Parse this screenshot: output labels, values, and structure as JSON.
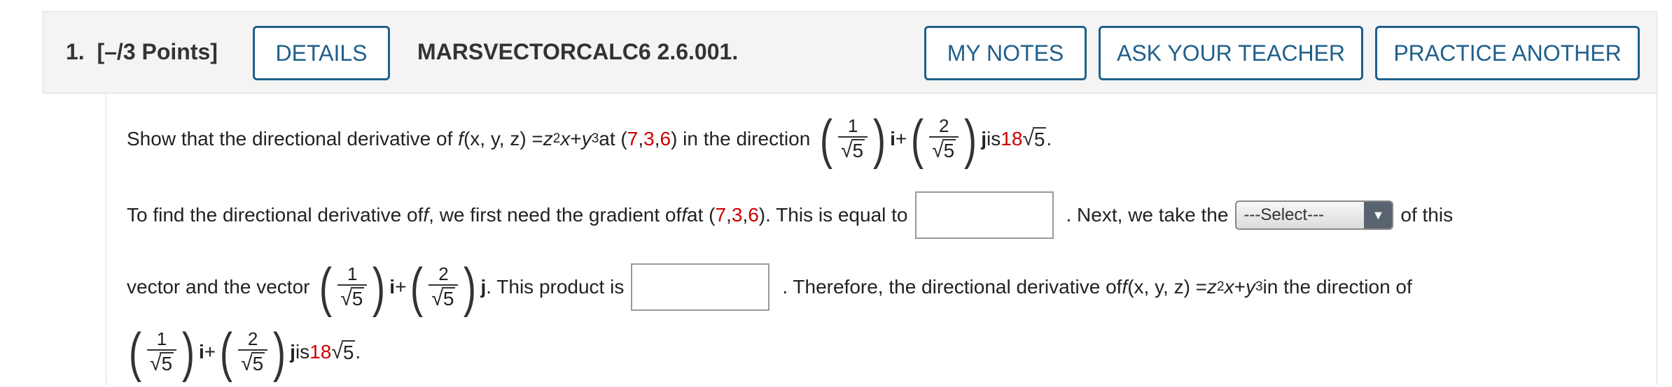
{
  "header": {
    "question_number": "1.",
    "points": "[–/3 Points]",
    "details_label": "DETAILS",
    "question_code": "MARSVECTORCALC6 2.6.001.",
    "my_notes_label": "MY NOTES",
    "ask_teacher_label": "ASK YOUR TEACHER",
    "practice_another_label": "PRACTICE ANOTHER"
  },
  "problem": {
    "intro": "Show that the directional derivative of",
    "f": "f",
    "args": "(x, y, z) = ",
    "z": "z",
    "exp2": "2",
    "x": "x",
    "plus_y": " + ",
    "y": "y",
    "exp3": "3",
    "at": " at (",
    "p1": "7",
    "comma": ", ",
    "p2": "3",
    "p3": "6",
    "close_dir": ") in the direction",
    "num1": "1",
    "num2": "2",
    "root": "5",
    "i": "i",
    "plus": " + ",
    "j": "j",
    "is": " is ",
    "coef": "18",
    "period": "."
  },
  "line2": {
    "text_a": "To find the directional derivative of ",
    "f": "f",
    "text_b": ", we first need the gradient of ",
    "text_c": " at (",
    "text_d": "). This is equal to",
    "text_e": ". Next, we take the",
    "select_value": "---Select---",
    "text_f": "of this"
  },
  "line3": {
    "text_a": "vector and the vector",
    "text_b": ". This product is",
    "text_c": ". Therefore, the directional derivative of ",
    "text_d": " in the direction of"
  }
}
